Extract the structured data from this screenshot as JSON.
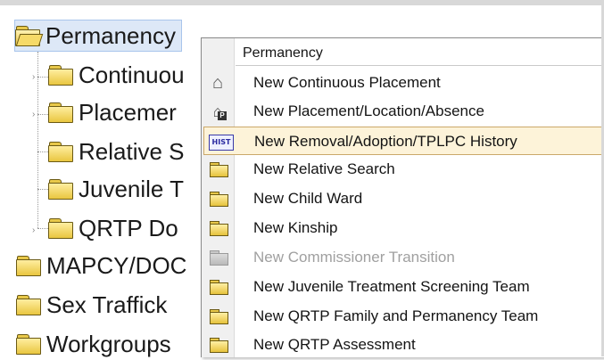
{
  "tree": {
    "items": [
      {
        "label": "Permanency",
        "selected": true
      },
      {
        "label": "Continuou"
      },
      {
        "label": "Placemer"
      },
      {
        "label": "Relative S"
      },
      {
        "label": "Juvenile T"
      },
      {
        "label": "QRTP Do"
      },
      {
        "label": "MAPCY/DOC"
      },
      {
        "label": "Sex Traffick"
      },
      {
        "label": "Workgroups"
      }
    ]
  },
  "menu": {
    "header": "Permanency",
    "items": [
      {
        "label": "New Continuous Placement",
        "icon": "house-icon"
      },
      {
        "label": "New Placement/Location/Absence",
        "icon": "house-p-icon"
      },
      {
        "label": "New Removal/Adoption/TPLPC History",
        "icon": "hist-icon",
        "highlighted": true
      },
      {
        "label": "New Relative Search",
        "icon": "folder-icon"
      },
      {
        "label": "New Child Ward",
        "icon": "folder-icon"
      },
      {
        "label": "New Kinship",
        "icon": "folder-icon"
      },
      {
        "label": "New Commissioner Transition",
        "icon": "folder-icon",
        "disabled": true
      },
      {
        "label": "New Juvenile Treatment Screening Team",
        "icon": "folder-icon"
      },
      {
        "label": "New QRTP Family and Permanency Team",
        "icon": "folder-icon"
      },
      {
        "label": "New QRTP Assessment",
        "icon": "folder-icon"
      }
    ]
  },
  "icons": {
    "hist_text": "HIST",
    "p_badge": "P"
  },
  "colors": {
    "highlight_bg": "#fdf3d9",
    "highlight_border": "#cba86a",
    "selected_bg": "#dde8f7",
    "disabled_text": "#a0a0a0"
  }
}
